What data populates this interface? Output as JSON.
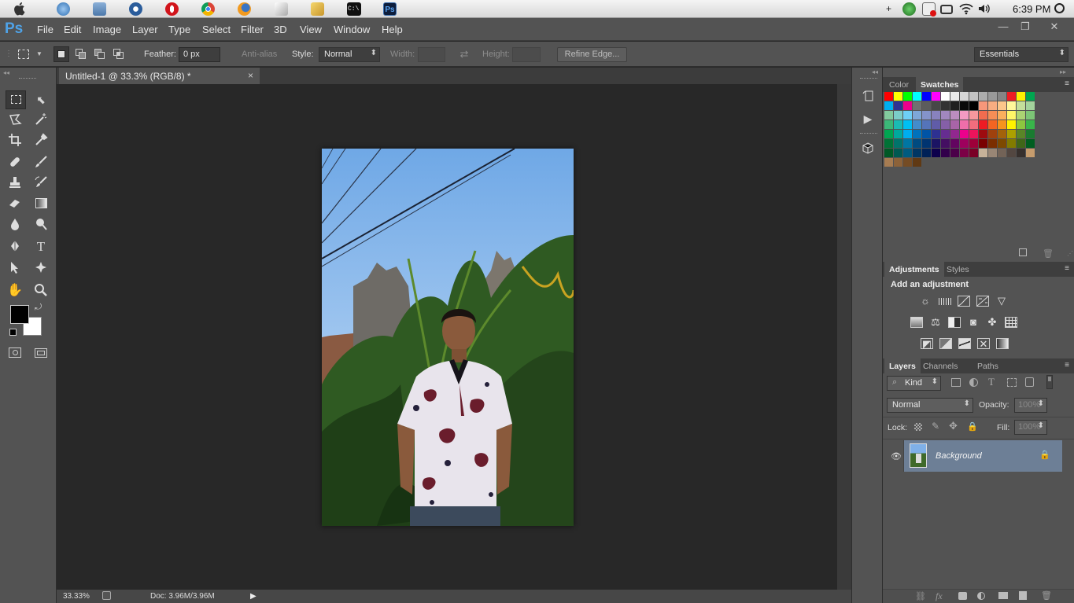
{
  "mac_menubar": {
    "clock": "6:39 PM",
    "dock_icons": [
      "apple-icon",
      "finder-icon",
      "library-icon",
      "quicktime-icon",
      "opera-icon",
      "chrome-icon",
      "firefox-icon",
      "document-icon",
      "tools-icon",
      "terminal-icon",
      "photoshop-icon"
    ],
    "status_icons": [
      "plus-icon",
      "network-globe-icon",
      "flag-icon",
      "remote-icon",
      "wifi-icon",
      "volume-icon",
      "spotlight-icon"
    ],
    "terminal_label": "C:\\",
    "ps_label": "Ps"
  },
  "app": {
    "logo": "Ps",
    "menus": [
      "File",
      "Edit",
      "Image",
      "Layer",
      "Type",
      "Select",
      "Filter",
      "3D",
      "View",
      "Window",
      "Help"
    ],
    "window_buttons": [
      "—",
      "❐",
      "✕"
    ]
  },
  "options_bar": {
    "feather_label": "Feather:",
    "feather_value": "0 px",
    "antialias_label": "Anti-alias",
    "style_label": "Style:",
    "style_value": "Normal",
    "width_label": "Width:",
    "height_label": "Height:",
    "refine_edge": "Refine Edge...",
    "workspace": "Essentials"
  },
  "document": {
    "tab_title": "Untitled-1 @ 33.3% (RGB/8) *",
    "close": "×",
    "zoom": "33.33%",
    "doc_info": "Doc: 3.96M/3.96M"
  },
  "color_panel": {
    "tabs": [
      "Color",
      "Swatches"
    ],
    "active_tab": "Swatches",
    "swatches": [
      "#ff0000",
      "#ffff00",
      "#00ff00",
      "#00ffff",
      "#0000ff",
      "#ff00ff",
      "#ffffff",
      "#ebebeb",
      "#d6d6d6",
      "#c2c2c2",
      "#adadad",
      "#999999",
      "#858585",
      "#ee1d24",
      "#fff200",
      "#00a650",
      "#00aeef",
      "#2e3192",
      "#ec008c",
      "#707070",
      "#5c5c5c",
      "#474747",
      "#333333",
      "#1f1f1f",
      "#0a0a0a",
      "#000000",
      "#f7977a",
      "#f9ad81",
      "#fdc68a",
      "#fff79a",
      "#c4df9b",
      "#a3d39c",
      "#82ca9d",
      "#7bcdc8",
      "#6ecff6",
      "#7ea7d8",
      "#8493ca",
      "#8882be",
      "#a187be",
      "#bc8dbf",
      "#f49ac2",
      "#f6989d",
      "#f26c4f",
      "#f68e56",
      "#fbaf5d",
      "#fff568",
      "#acd373",
      "#7cc576",
      "#3bb878",
      "#1abbb4",
      "#00bff3",
      "#438ccb",
      "#5574b9",
      "#605ca8",
      "#855fa8",
      "#a864a8",
      "#f06eaa",
      "#f26d7d",
      "#ed1c24",
      "#f26522",
      "#f7941d",
      "#fff200",
      "#8dc63f",
      "#39b54a",
      "#00a651",
      "#00a99d",
      "#00aeef",
      "#0072bc",
      "#0054a6",
      "#2e3192",
      "#662d91",
      "#92278f",
      "#ec008c",
      "#ed145b",
      "#9e0b0f",
      "#a0410d",
      "#a3620a",
      "#aba000",
      "#598527",
      "#197b30",
      "#007236",
      "#00746b",
      "#0076a3",
      "#004b80",
      "#003471",
      "#1b1464",
      "#440e62",
      "#630460",
      "#9e005d",
      "#9e0039",
      "#790000",
      "#7b2e00",
      "#7d4900",
      "#827b00",
      "#406618",
      "#005e20",
      "#005826",
      "#005952",
      "#005b7f",
      "#003663",
      "#002157",
      "#0d004c",
      "#32004b",
      "#4b0049",
      "#7b0046",
      "#7a0026",
      "#c7b299",
      "#998675",
      "#736357",
      "#534741",
      "#37302d",
      "#c69c6d",
      "#a67c52",
      "#8c6239",
      "#754c24",
      "#603913"
    ]
  },
  "adjustments_panel": {
    "tabs": [
      "Adjustments",
      "Styles"
    ],
    "title": "Add an adjustment",
    "icons": [
      [
        "brightness-contrast-icon",
        "levels-icon",
        "curves-icon",
        "exposure-icon",
        "vibrance-icon"
      ],
      [
        "hue-saturation-icon",
        "color-balance-icon",
        "black-white-icon",
        "photo-filter-icon",
        "channel-mixer-icon",
        "color-lookup-icon"
      ],
      [
        "invert-icon",
        "posterize-icon",
        "threshold-icon",
        "selective-color-icon",
        "gradient-map-icon"
      ]
    ]
  },
  "layers_panel": {
    "tabs": [
      "Layers",
      "Channels",
      "Paths"
    ],
    "kind_label": "Kind",
    "blend_mode": "Normal",
    "opacity_label": "Opacity:",
    "opacity_value": "100%",
    "lock_label": "Lock:",
    "fill_label": "Fill:",
    "fill_value": "100%",
    "layers": [
      {
        "name": "Background",
        "visible": true,
        "locked": true
      }
    ]
  }
}
